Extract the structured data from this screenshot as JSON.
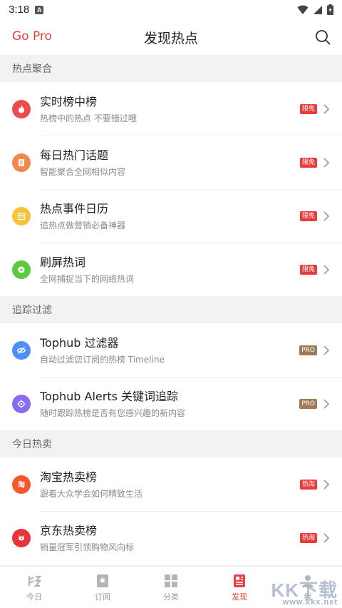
{
  "status": {
    "time": "3:18",
    "notif_letter": "A"
  },
  "header": {
    "gopro": "Go Pro",
    "title": "发现热点"
  },
  "sections": [
    {
      "title": "热点聚合",
      "items": [
        {
          "title": "实时榜中榜",
          "subtitle": "热榜中的热点 不要错过哦",
          "badge": "限免",
          "color": "#ef4b4b"
        },
        {
          "title": "每日热门话题",
          "subtitle": "智能聚合全网相似内容",
          "badge": "限免",
          "color": "#f2884e"
        },
        {
          "title": "热点事件日历",
          "subtitle": "追热点做营销必备神器",
          "badge": "限免",
          "color": "#f8c33a"
        },
        {
          "title": "刷屏热词",
          "subtitle": "全网捕捉当下的网络热词",
          "badge": "限免",
          "color": "#5cc93f"
        }
      ]
    },
    {
      "title": "追踪过滤",
      "items": [
        {
          "title": "Tophub 过滤器",
          "subtitle": "自动过滤您订阅的热榜 Timeline",
          "badge": "PRO",
          "color": "#4f8ef7"
        },
        {
          "title": "Tophub Alerts 关键词追踪",
          "subtitle": "随时跟踪热榜是否有您感兴趣的新内容",
          "badge": "PRO",
          "color": "#8a6bf0"
        }
      ]
    },
    {
      "title": "今日热卖",
      "items": [
        {
          "title": "淘宝热卖榜",
          "subtitle": "跟着大众学会如何精致生活",
          "badge": "热淘",
          "color": "#f5582a"
        },
        {
          "title": "京东热卖榜",
          "subtitle": "销量冠军引领购物风向标",
          "badge": "热淘",
          "color": "#e7363a"
        }
      ]
    }
  ],
  "tabs": [
    {
      "label": "今日",
      "icon": "today-icon"
    },
    {
      "label": "订阅",
      "icon": "star-icon"
    },
    {
      "label": "分类",
      "icon": "grid-icon"
    },
    {
      "label": "发现",
      "icon": "discover-icon",
      "active": true
    },
    {
      "label": "我",
      "icon": "user-icon"
    }
  ],
  "watermark": {
    "main": "KK下载",
    "sub": "www.kkx.net"
  },
  "colors": {
    "accent": "#e9423e",
    "badge_red": "#ea3a3a",
    "badge_pro": "#a07a55"
  }
}
